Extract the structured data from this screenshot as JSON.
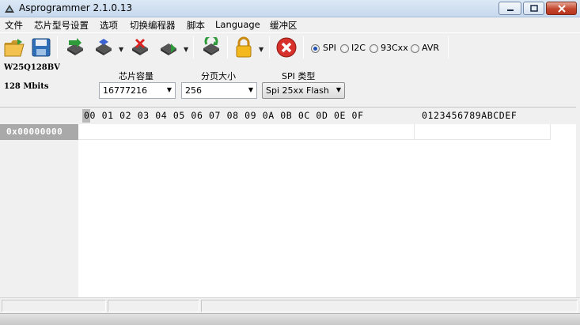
{
  "window": {
    "title": "Asprogrammer 2.1.0.13",
    "controls": {
      "minimize": "minimize",
      "maximize": "maximize",
      "close": "close"
    }
  },
  "menu": {
    "items": [
      "文件",
      "芯片型号设置",
      "选项",
      "切换编程器",
      "脚本",
      "Language",
      "缓冲区"
    ]
  },
  "toolbar": {
    "icons": [
      "open-folder-icon",
      "save-disk-icon",
      "read-chip-icon",
      "write-chip-icon",
      "erase-chip-icon",
      "verify-chip-icon",
      "chip-id-icon",
      "lock-icon",
      "stop-icon"
    ],
    "protocols": [
      {
        "label": "SPI",
        "selected": true
      },
      {
        "label": "I2C",
        "selected": false
      },
      {
        "label": "93Cxx",
        "selected": false
      },
      {
        "label": "AVR",
        "selected": false
      }
    ]
  },
  "chip": {
    "name": "W25Q128BV",
    "size": "128 Mbits"
  },
  "fields": {
    "capacity": {
      "label": "芯片容量",
      "value": "16777216"
    },
    "page_size": {
      "label": "分页大小",
      "value": "256"
    },
    "spi_type": {
      "label": "SPI 类型",
      "value": "Spi 25xx Flash"
    }
  },
  "hex": {
    "header": "00 01 02 03 04 05 06 07 08 09 0A 0B 0C 0D 0E 0F",
    "ascii_header": "0123456789ABCDEF",
    "rows": [
      {
        "address": "0x00000000"
      }
    ]
  },
  "colors": {
    "title_bg": "#c7d9ee",
    "chrome_bg": "#f0f0f0",
    "address_bg": "#a9a9a9",
    "close_button": "#c3472f"
  }
}
